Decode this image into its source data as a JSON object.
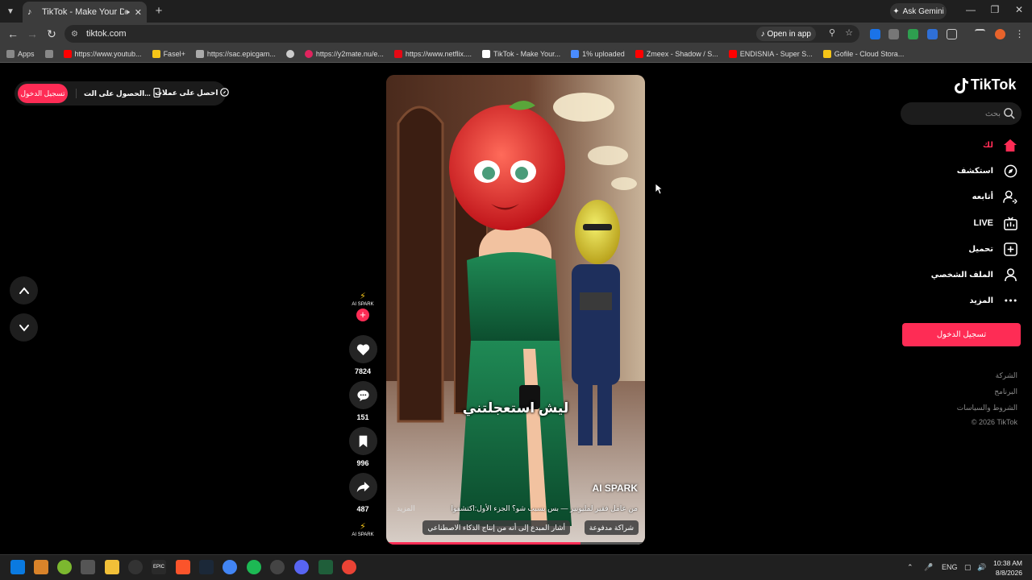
{
  "browser": {
    "tab_title": "TikTok - Make Your Day",
    "ask_gemini": "Ask Gemini",
    "url": "tiktok.com",
    "open_in_app": "Open in app",
    "bookmarks": [
      {
        "label": "Apps",
        "color": "#888888"
      },
      {
        "label": "",
        "color": "#888888"
      },
      {
        "label": "https://www.youtub...",
        "color": "#ff0000"
      },
      {
        "label": "Fasel+",
        "color": "#f5c518"
      },
      {
        "label": "https://sac.epicgam...",
        "color": "#aaaaaa"
      },
      {
        "label": "",
        "color": "#cccccc"
      },
      {
        "label": "https://y2mate.nu/e...",
        "color": "#e0245e"
      },
      {
        "label": "https://www.netflix....",
        "color": "#e50914"
      },
      {
        "label": "TikTok - Make Your...",
        "color": "#ffffff"
      },
      {
        "label": "1% uploaded",
        "color": "#4a8cff"
      },
      {
        "label": "Zmeex - Shadow / S...",
        "color": "#ff0000"
      },
      {
        "label": "ENDISNIA - Super S...",
        "color": "#ff0000"
      },
      {
        "label": "Gofile - Cloud Stora...",
        "color": "#f5c518"
      }
    ]
  },
  "top_pill": {
    "login": "تسجيل الدخول",
    "get_app": "الحصول على الت...",
    "get_coins": "احصل على عملات"
  },
  "video": {
    "subtitle": "ليش استعجلتني",
    "watermark": "AI SPARK",
    "caption": "من عامل فقير لمليونير — بس بسبب شو؟ الجزء الأول:اكتشفوا",
    "more": "المزيد",
    "tags": [
      "شراكة مدفوعة",
      "أشار المبدع إلى أنه من إنتاج الذكاء الاصطناعي"
    ],
    "progress": 0.75
  },
  "actions": {
    "creator": "AI SPARK",
    "likes": "7824",
    "comments": "151",
    "saves": "996",
    "shares": "487"
  },
  "sidebar": {
    "logo": "TikTok",
    "search_placeholder": "بحث",
    "nav": [
      {
        "label": "لك",
        "icon": "home-icon",
        "active": true
      },
      {
        "label": "استكشف",
        "icon": "compass-icon",
        "active": false
      },
      {
        "label": "أتابعه",
        "icon": "following-icon",
        "active": false
      },
      {
        "label": "LIVE",
        "icon": "live-icon",
        "active": false
      },
      {
        "label": "تحميل",
        "icon": "upload-icon",
        "active": false
      },
      {
        "label": "الملف الشخصي",
        "icon": "profile-icon",
        "active": false
      },
      {
        "label": "المزيد",
        "icon": "more-icon",
        "active": false
      }
    ],
    "login": "تسجيل الدخول",
    "footer": [
      "الشركة",
      "البرنامج",
      "الشروط والسياسات",
      "© 2026 TikTok"
    ]
  },
  "taskbar": {
    "lang": "ENG",
    "time": "10:38 AM",
    "date": "8/8/2026"
  },
  "colors": {
    "accent": "#fe2c55"
  }
}
